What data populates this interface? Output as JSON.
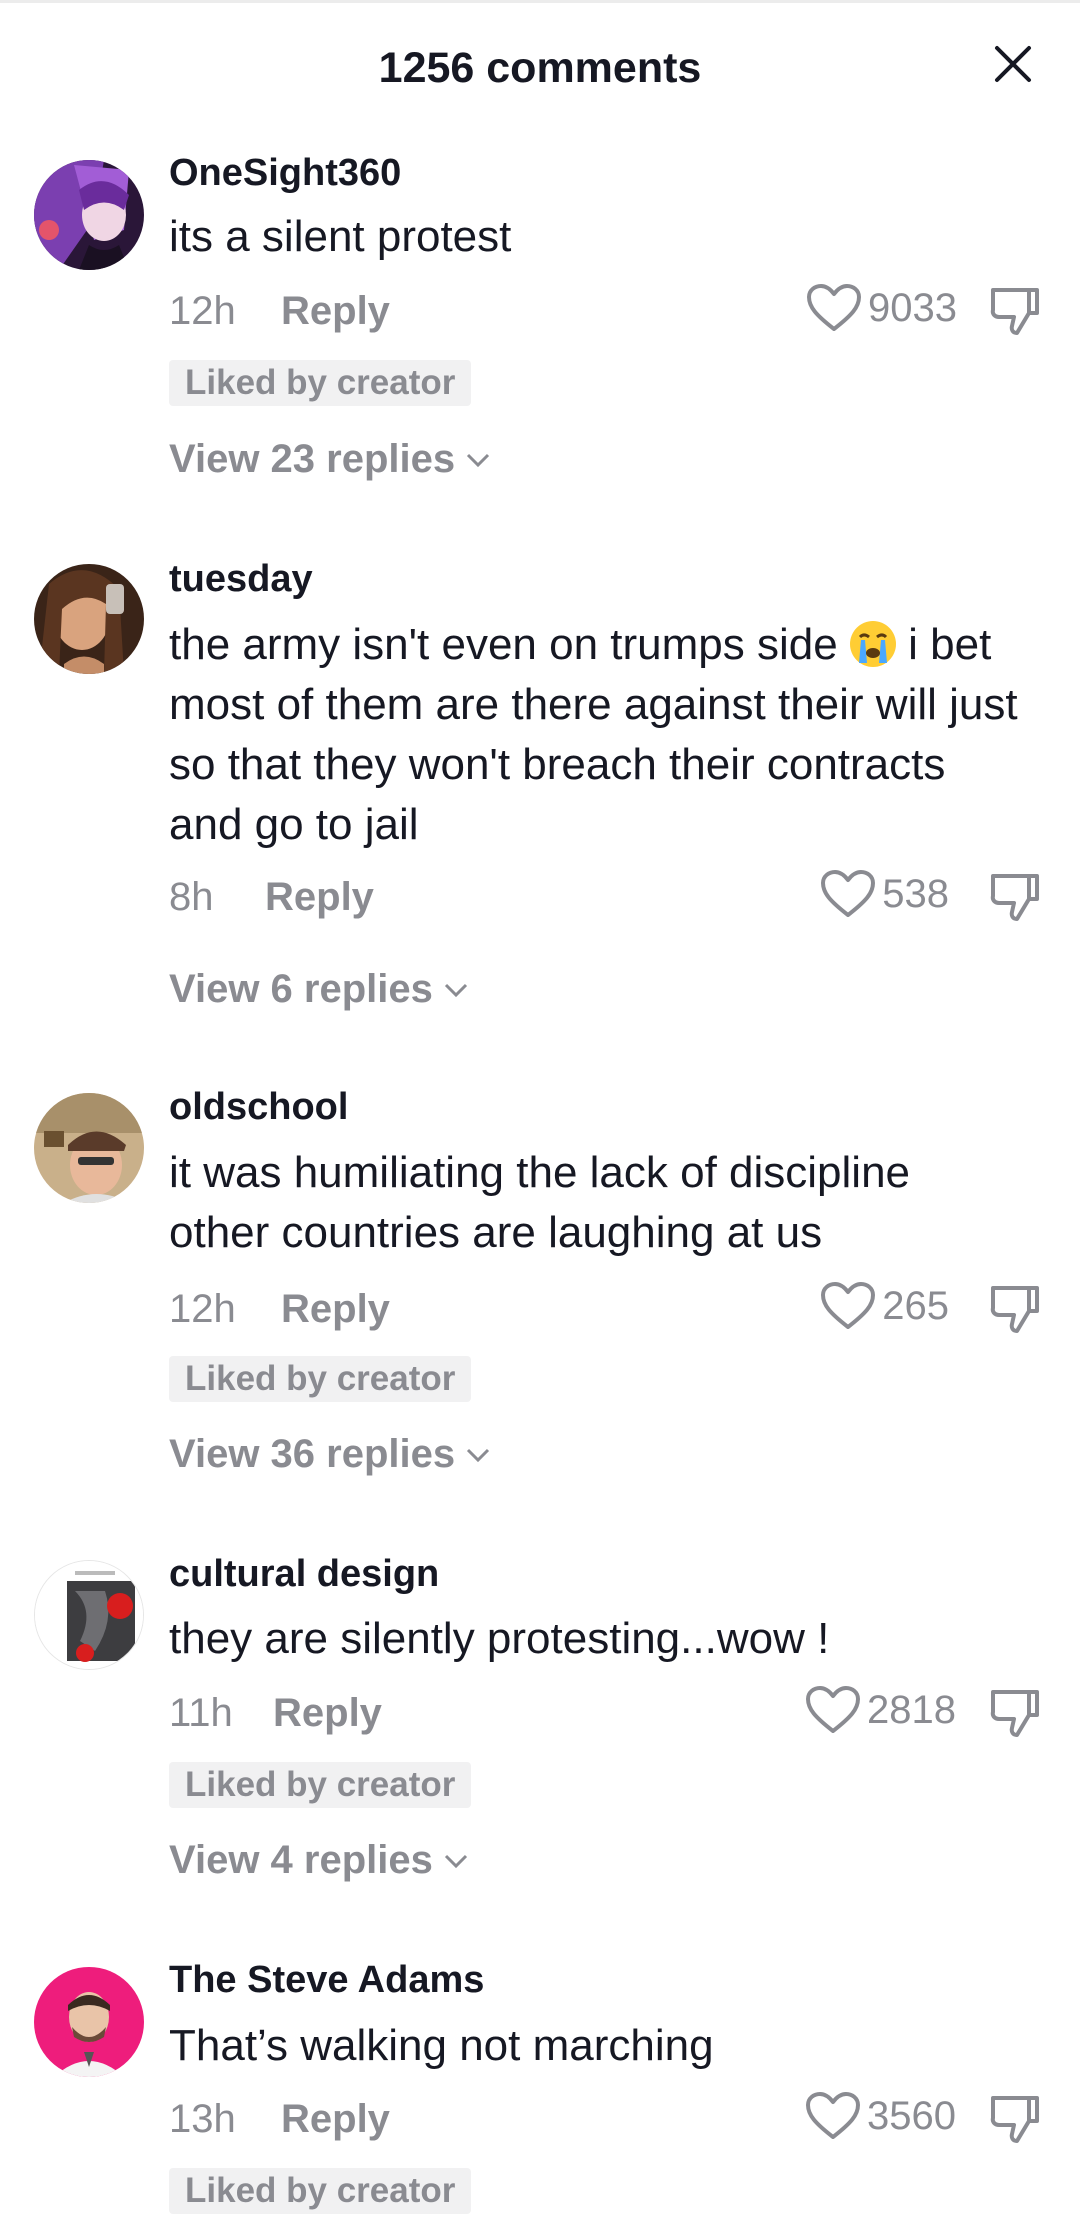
{
  "header": {
    "title": "1256 comments"
  },
  "comments": [
    {
      "username": "OneSight360",
      "text": "its a silent protest",
      "time": "12h",
      "reply_label": "Reply",
      "likes": "9033",
      "badge": "Liked by creator",
      "view_replies": "View 23 replies"
    },
    {
      "username": "tuesday",
      "text_before_emoji": "the army isn't even on trumps side ",
      "emoji": "loudly-crying-face",
      "text_after_emoji": " i bet most of them are there against their will just so that they won't breach their contracts and go to jail",
      "time": "8h",
      "reply_label": "Reply",
      "likes": "538",
      "view_replies": "View 6 replies"
    },
    {
      "username": "oldschool",
      "text": "it was humiliating the lack of discipline other countries are laughing at us",
      "time": "12h",
      "reply_label": "Reply",
      "likes": "265",
      "badge": "Liked by creator",
      "view_replies": "View 36 replies"
    },
    {
      "username": "cultural design",
      "text": "they are silently protesting...wow !",
      "time": "11h",
      "reply_label": "Reply",
      "likes": "2818",
      "badge": "Liked by creator",
      "view_replies": "View 4 replies"
    },
    {
      "username": "The Steve Adams",
      "text": "That’s walking not marching",
      "time": "13h",
      "reply_label": "Reply",
      "likes": "3560",
      "badge": "Liked by creator"
    }
  ],
  "icons": {
    "close": "close-icon",
    "like": "heart-outline-icon",
    "dislike": "thumbs-down-icon",
    "expand": "chevron-down-icon"
  },
  "colors": {
    "text_primary": "#161823",
    "text_secondary": "#8a8b91",
    "badge_bg": "#f1f1f2"
  }
}
